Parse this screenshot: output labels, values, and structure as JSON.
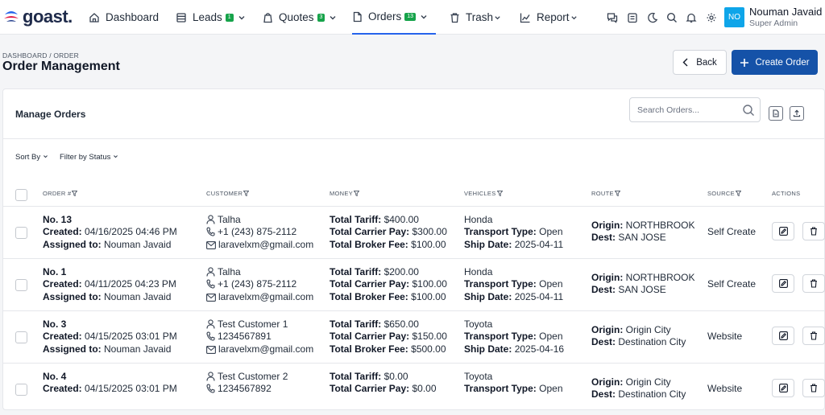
{
  "brand": {
    "name": "goast."
  },
  "nav": {
    "dashboard": "Dashboard",
    "leads": "Leads",
    "leads_badge": "1",
    "quotes": "Quotes",
    "quotes_badge": "3",
    "orders": "Orders",
    "orders_badge": "13",
    "trash": "Trash",
    "report": "Report"
  },
  "user": {
    "initials": "NO",
    "name": "Nouman Javaid",
    "role": "Super Admin"
  },
  "page": {
    "breadcrumb": "DASHBOARD / ORDER",
    "title": "Order Management",
    "back_label": "Back",
    "create_label": "Create Order"
  },
  "card": {
    "title": "Manage Orders",
    "search_placeholder": "Search Orders..."
  },
  "filters": {
    "sort_by": "Sort By",
    "filter_status": "Filter by Status"
  },
  "columns": {
    "order": "ORDER #",
    "customer": "CUSTOMER",
    "money": "MONEY",
    "vehicles": "VEHICLES",
    "route": "ROUTE",
    "source": "SOURCE",
    "actions": "ACTIONS"
  },
  "labels": {
    "created": "Created:",
    "assigned": "Assigned to:",
    "total_tariff": "Total Tariff:",
    "total_carrier_pay": "Total Carrier Pay:",
    "total_broker_fee": "Total Broker Fee:",
    "transport_type": "Transport Type:",
    "ship_date": "Ship Date:",
    "origin": "Origin:",
    "dest": "Dest:"
  },
  "orders": [
    {
      "no": "No. 13",
      "created": "04/16/2025 04:46 PM",
      "assigned": "Nouman Javaid",
      "customer": "Talha",
      "phone": "+1 (243) 875-2112",
      "email": "laravelxm@gmail.com",
      "tariff": "$400.00",
      "carrier_pay": "$300.00",
      "broker_fee": "$100.00",
      "make": "Honda",
      "transport": "Open",
      "ship_date": "2025-04-11",
      "origin": "NORTHBROOK",
      "dest": "SAN JOSE",
      "source": "Self Create"
    },
    {
      "no": "No. 1",
      "created": "04/11/2025 04:23 PM",
      "assigned": "Nouman Javaid",
      "customer": "Talha",
      "phone": "+1 (243) 875-2112",
      "email": "laravelxm@gmail.com",
      "tariff": "$200.00",
      "carrier_pay": "$100.00",
      "broker_fee": "$100.00",
      "make": "Honda",
      "transport": "Open",
      "ship_date": "2025-04-11",
      "origin": "NORTHBROOK",
      "dest": "SAN JOSE",
      "source": "Self Create"
    },
    {
      "no": "No. 3",
      "created": "04/15/2025 03:01 PM",
      "assigned": "Nouman Javaid",
      "customer": "Test Customer 1",
      "phone": "1234567891",
      "email": "laravelxm@gmail.com",
      "tariff": "$650.00",
      "carrier_pay": "$150.00",
      "broker_fee": "$500.00",
      "make": "Toyota",
      "transport": "Open",
      "ship_date": "2025-04-16",
      "origin": "Origin City",
      "dest": "Destination City",
      "source": "Website"
    },
    {
      "no": "No. 4",
      "created": "04/15/2025 03:01 PM",
      "assigned": "",
      "customer": "Test Customer 2",
      "phone": "1234567892",
      "email": "",
      "tariff": "$0.00",
      "carrier_pay": "$0.00",
      "broker_fee": "",
      "make": "Toyota",
      "transport": "Open",
      "ship_date": "",
      "origin": "Origin City",
      "dest": "Destination City",
      "source": "Website"
    }
  ]
}
